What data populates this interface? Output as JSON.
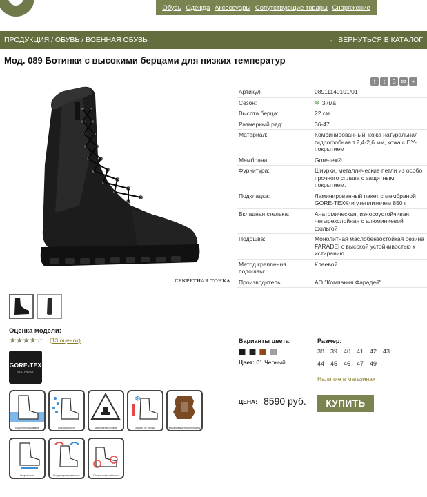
{
  "nav": {
    "items": [
      {
        "label": "Обувь"
      },
      {
        "label": "Одежда"
      },
      {
        "label": "Аксессуары"
      },
      {
        "label": "Сопутствующие товары"
      },
      {
        "label": "Снаряжение"
      }
    ]
  },
  "breadcrumb": {
    "path": "ПРОДУКЦИЯ / ОБУВЬ / ВОЕННАЯ ОБУВЬ",
    "back_label": "← ВЕРНУТЬСЯ В КАТАЛОГ"
  },
  "product": {
    "title": "Мод. 089 Ботинки с высокими берцами для низких температур",
    "watermark": "СЕКРЕТНАЯ ТОЧКА",
    "share_icons": [
      "facebook-icon",
      "twitter-icon",
      "vk-icon",
      "email-icon",
      "plus-icon"
    ],
    "share_glyphs": [
      "f",
      "t",
      "B",
      "✉",
      "+"
    ]
  },
  "specs": [
    {
      "key": "Артикул",
      "value": "08911140101/01"
    },
    {
      "key": "Сезон:",
      "value": "Зима"
    },
    {
      "key": "Высота берца:",
      "value": "22 см"
    },
    {
      "key": "Размерный ряд:",
      "value": "36-47"
    },
    {
      "key": "Материал:",
      "value": "Комбинированный: кожа натуральная гидрофобная т.2,4-2,6 мм, кожа с ПУ-покрытием"
    },
    {
      "key": "Мембрана:",
      "value": "Gore-tex®"
    },
    {
      "key": "Фурнитура:",
      "value": "Шнурки, металлические петли из особо прочного сплава с защитным покрытием."
    },
    {
      "key": "Подкладка:",
      "value": "Ламинированный пакет с мембраной GORE-TEX® и утеплителем 850 г"
    },
    {
      "key": "Вкладная стелька:",
      "value": "Анатомическая, износоустойчивая, четырехслойная с алюминиевой фольгой"
    },
    {
      "key": "Подошва:",
      "value": "Монолитная маслобензостойкая резина FARADEI с высокой устойчивостью к истиранию"
    },
    {
      "key": "Метод крепления подошвы:",
      "value": "Клеевой"
    },
    {
      "key": "Производитель:",
      "value": "АО \"Компания Фарадей\""
    }
  ],
  "rating": {
    "label": "Оценка модели:",
    "stars_filled": "★★★★",
    "stars_empty": "☆",
    "value": 4,
    "max": 5,
    "reviews": "(13 оценок)"
  },
  "badge": {
    "line1": "GORE-TEX",
    "line2": "FOOTWEAR"
  },
  "features": [
    {
      "icon": "waterproof-boot-icon",
      "caption": "Водонепроницаемые"
    },
    {
      "icon": "water-repellent-icon",
      "caption": "Гидрофобность"
    },
    {
      "icon": "oil-resistant-icon",
      "caption": "Маслобензостойкие"
    },
    {
      "icon": "cold-protection-icon",
      "caption": "Защита от холода"
    },
    {
      "icon": "leather-icon",
      "caption": "Кожа повышенной толщины"
    },
    {
      "icon": "shock-absorption-icon",
      "caption": "Амортизация"
    },
    {
      "icon": "breathability-icon",
      "caption": "Воздухопроницаемость"
    },
    {
      "icon": "flexibility-icon",
      "caption": "Оптимальная гибкость"
    }
  ],
  "variants": {
    "label": "Варианты цвета:",
    "colors": [
      "#1a1a1a",
      "#222222",
      "#8b4a1c",
      "#a0a0a0"
    ],
    "current_prefix": "Цвет:",
    "current": "01 Черный"
  },
  "sizes": {
    "label": "Размер:",
    "values": [
      "38",
      "39",
      "40",
      "41",
      "42",
      "43",
      "44",
      "45",
      "46",
      "47",
      "49"
    ],
    "stores_link": "Наличие в магазинах"
  },
  "price": {
    "label": "ЦЕНА:",
    "value": "8590 руб.",
    "buy_label": "КУПИТЬ"
  },
  "colors": {
    "brand": "#7a8450",
    "band": "#636d3e",
    "link": "#8a7d2a"
  }
}
